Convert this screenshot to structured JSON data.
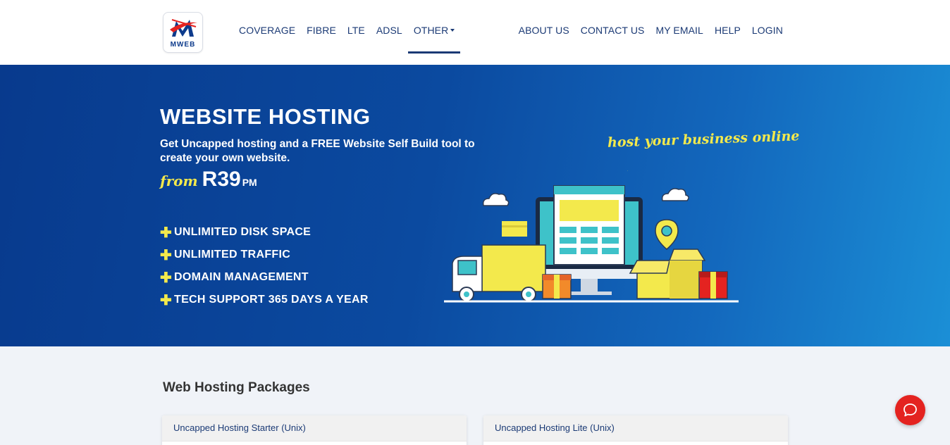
{
  "header": {
    "logo_text": "MWEB",
    "nav_left": [
      {
        "label": "COVERAGE"
      },
      {
        "label": "FIBRE"
      },
      {
        "label": "LTE"
      },
      {
        "label": "ADSL"
      },
      {
        "label": "OTHER"
      }
    ],
    "nav_right": [
      {
        "label": "ABOUT US"
      },
      {
        "label": "CONTACT US"
      },
      {
        "label": "MY EMAIL"
      },
      {
        "label": "HELP"
      },
      {
        "label": "LOGIN"
      }
    ]
  },
  "hero": {
    "title": "WEBSITE HOSTING",
    "subtitle": "Get Uncapped hosting and a FREE Website Self Build tool to create your own website.",
    "price_from": "from",
    "price_amount": "R39",
    "price_unit": "PM",
    "tagline": "host your business online",
    "features": [
      "UNLIMITED DISK SPACE",
      "UNLIMITED TRAFFIC",
      "DOMAIN MANAGEMENT",
      "TECH SUPPORT 365 DAYS A YEAR"
    ]
  },
  "packages": {
    "title": "Web Hosting Packages",
    "cards": [
      {
        "name": "Uncapped Hosting Starter (Unix)"
      },
      {
        "name": "Uncapped Hosting Lite (Unix)"
      }
    ]
  },
  "colors": {
    "brand_navy": "#1b3a75",
    "hero_blue": "#0b4aa0",
    "accent_yellow": "#f3e94c",
    "chat_red": "#e42320"
  },
  "icons": {
    "logo": "mweb-logo-icon",
    "chat": "chat-bubble-icon",
    "feature_bullet": "plus-icon"
  }
}
